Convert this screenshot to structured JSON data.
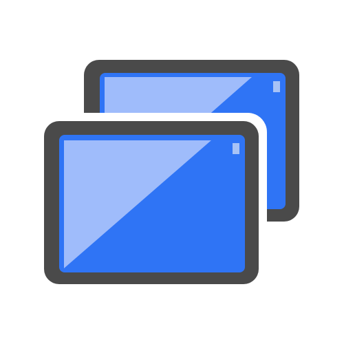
{
  "icon": {
    "name": "remote-desktop-icon",
    "colors": {
      "background": "#ffffff",
      "frame": "#4a4a4a",
      "screen_blue": "#2f74f5",
      "screen_highlight": "#9fbcfb",
      "indicator": "#a8c3f6",
      "outline_gap": "#ffffff"
    }
  }
}
